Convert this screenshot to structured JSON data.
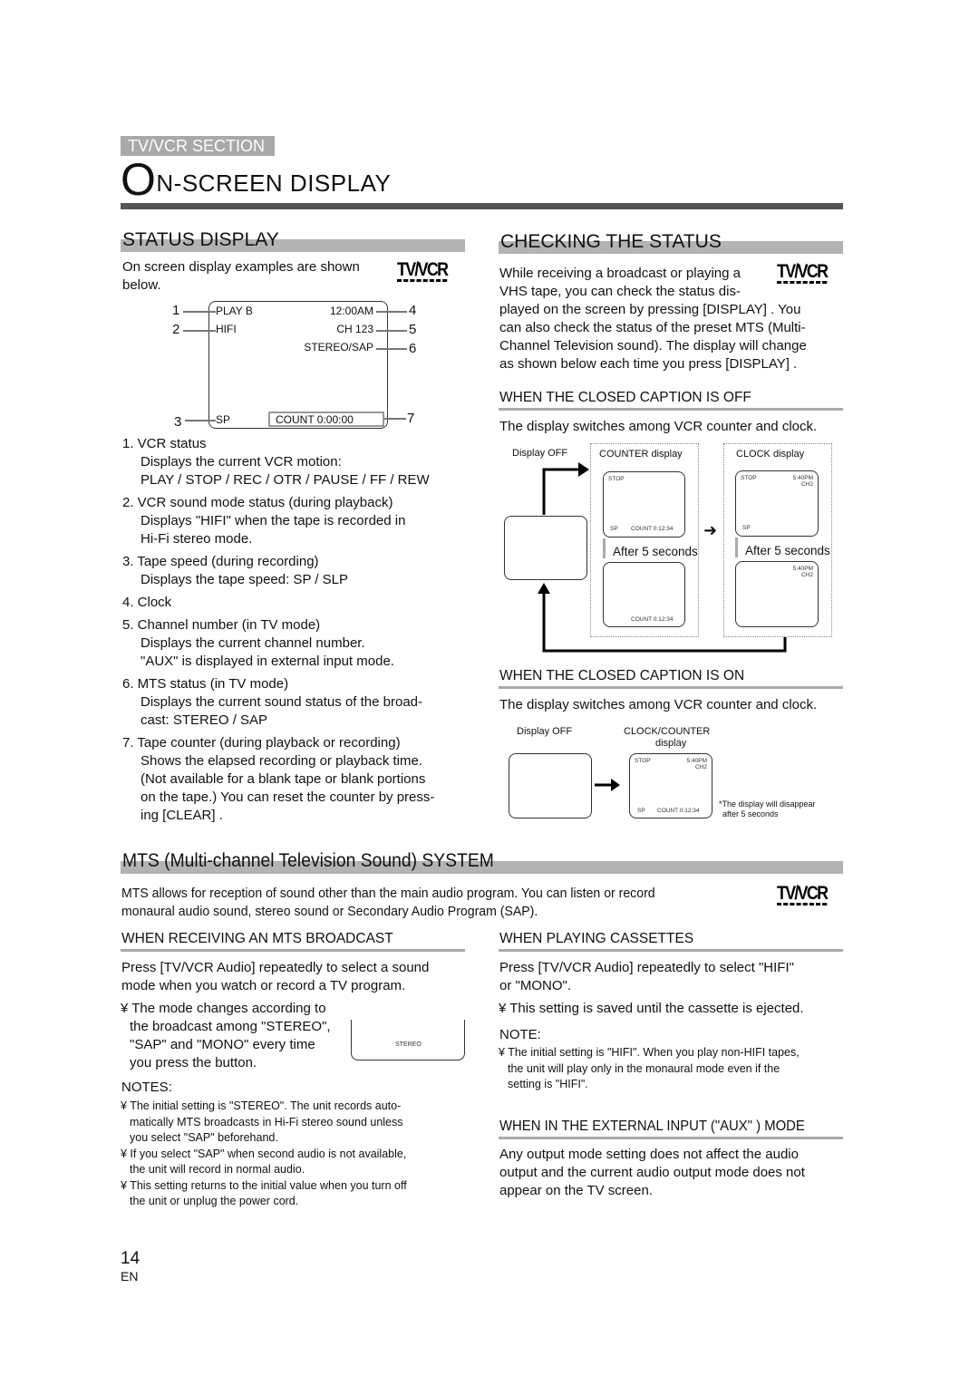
{
  "section_tag": "TV/VCR SECTION",
  "page_title": {
    "first_letter": "O",
    "rest": "N-SCREEN DISPLAY"
  },
  "logo_text": "TV/VCR",
  "status_display": {
    "heading": "STATUS DISPLAY",
    "intro": "On screen display examples are shown below.",
    "osd": {
      "vcr_status": "PLAY B",
      "sound_mode": "HIFI",
      "clock": "12:00AM",
      "channel": "CH 123",
      "mts": "STEREO/SAP",
      "tape_speed": "SP",
      "counter": "COUNT   0:00:00",
      "callouts": [
        "1",
        "2",
        "3",
        "4",
        "5",
        "6",
        "7"
      ]
    },
    "items": [
      {
        "title": "1. VCR status",
        "lines": [
          "Displays the current VCR motion:",
          "PLAY / STOP / REC / OTR / PAUSE / FF / REW"
        ]
      },
      {
        "title": "2. VCR sound mode status    (during playback)",
        "lines": [
          "Displays \"HIFI\" when the tape is recorded in",
          "Hi-Fi stereo mode."
        ]
      },
      {
        "title": "3. Tape speed  (during recording)",
        "lines": [
          "Displays the tape speed: SP / SLP"
        ]
      },
      {
        "title": "4. Clock",
        "lines": []
      },
      {
        "title": "5. Channel number   (in TV mode)",
        "lines": [
          "Displays the current channel number.",
          "\"AUX\" is displayed in external input mode."
        ]
      },
      {
        "title": "6. MTS status  (in TV mode)",
        "lines": [
          "Displays the current sound status of the broad-",
          "cast: STEREO / SAP"
        ]
      },
      {
        "title": "7. Tape counter   (during playback or recording)",
        "lines": [
          "Shows the elapsed recording or playback time.",
          "(Not available for a blank tape or blank portions",
          "on the tape.) You can reset the counter by press-",
          "ing [CLEAR] ."
        ]
      }
    ]
  },
  "checking_status": {
    "heading": "CHECKING THE STATUS",
    "intro_lines": [
      "While receiving a broadcast or playing a",
      "VHS tape, you can check the status dis-",
      "played on the screen by pressing [DISPLAY] . You",
      "can also check the status of the preset MTS (Multi-",
      "Channel Television sound). The display will change",
      "as shown below each time you press [DISPLAY] ."
    ],
    "cc_off": {
      "heading": "WHEN THE CLOSED CAPTION IS OFF",
      "text": "The display switches among VCR counter and clock.",
      "display_off_label": "Display OFF",
      "counter_label": "COUNTER display",
      "clock_label": "CLOCK display",
      "after_label": "After 5 seconds",
      "stop": "STOP",
      "sp": "SP",
      "count": "COUNT  0:12:34",
      "time": "5:40PM",
      "ch": "CH2"
    },
    "cc_on": {
      "heading": "WHEN THE CLOSED CAPTION IS ON",
      "text": "The display switches among VCR counter and clock.",
      "display_off_label": "Display OFF",
      "clock_counter_label": "CLOCK/COUNTER",
      "clock_counter_label2": "display",
      "note": "*The display will disappear",
      "note2": "after 5 seconds",
      "stop": "STOP",
      "sp": "SP",
      "count": "COUNT  0:12:34",
      "time": "5:40PM",
      "ch": "CH2"
    }
  },
  "mts": {
    "heading": "MTS (Multi-channel Television Sound) SYSTEM",
    "intro_lines": [
      "MTS allows for reception of sound other than the main audio program. You can listen or record",
      "monaural audio sound, stereo sound or Secondary Audio Program  (SAP)."
    ],
    "receiving": {
      "heading": "WHEN RECEIVING AN MTS BROADCAST",
      "text_lines": [
        "Press [TV/VCR Audio]  repeatedly to select a sound",
        "mode when you watch or record a TV program."
      ],
      "bullet_lines": [
        "¥ The mode changes according to",
        "the broadcast among \"STEREO\",",
        " \"SAP\" and \"MONO\" every time",
        "you press the button."
      ],
      "screen_text": "STEREO",
      "notes_heading": "NOTES:",
      "notes": [
        [
          "¥ The initial setting is \"STEREO\". The unit records auto-",
          "matically MTS broadcasts in Hi-Fi stereo sound unless",
          "you select \"SAP\" beforehand."
        ],
        [
          "¥ If you select \"SAP\" when second audio is not available,",
          "the unit will record in normal audio."
        ],
        [
          "¥ This setting returns to the initial value when you turn off",
          "the unit or unplug the power cord."
        ]
      ]
    },
    "cassettes": {
      "heading": "WHEN PLAYING CASSETTES",
      "text_lines": [
        "Press [TV/VCR Audio]  repeatedly to select \"HIFI\"",
        "or \"MONO\"."
      ],
      "bullet": "¥ This setting is saved until the cassette is ejected.",
      "note_heading": "NOTE:",
      "note_lines": [
        "¥ The initial setting is \"HIFI\". When you play non-HIFI tapes,",
        "the unit will play only in the monaural mode even if the",
        "setting is \"HIFI\"."
      ]
    },
    "aux": {
      "heading": "WHEN IN THE EXTERNAL INPUT (\"AUX\" ) MODE",
      "text_lines": [
        "Any output mode setting does not affect the audio",
        "output and the current audio output mode does not",
        "appear on the TV screen."
      ]
    }
  },
  "footer": {
    "page_number": "14",
    "lang": "EN"
  }
}
